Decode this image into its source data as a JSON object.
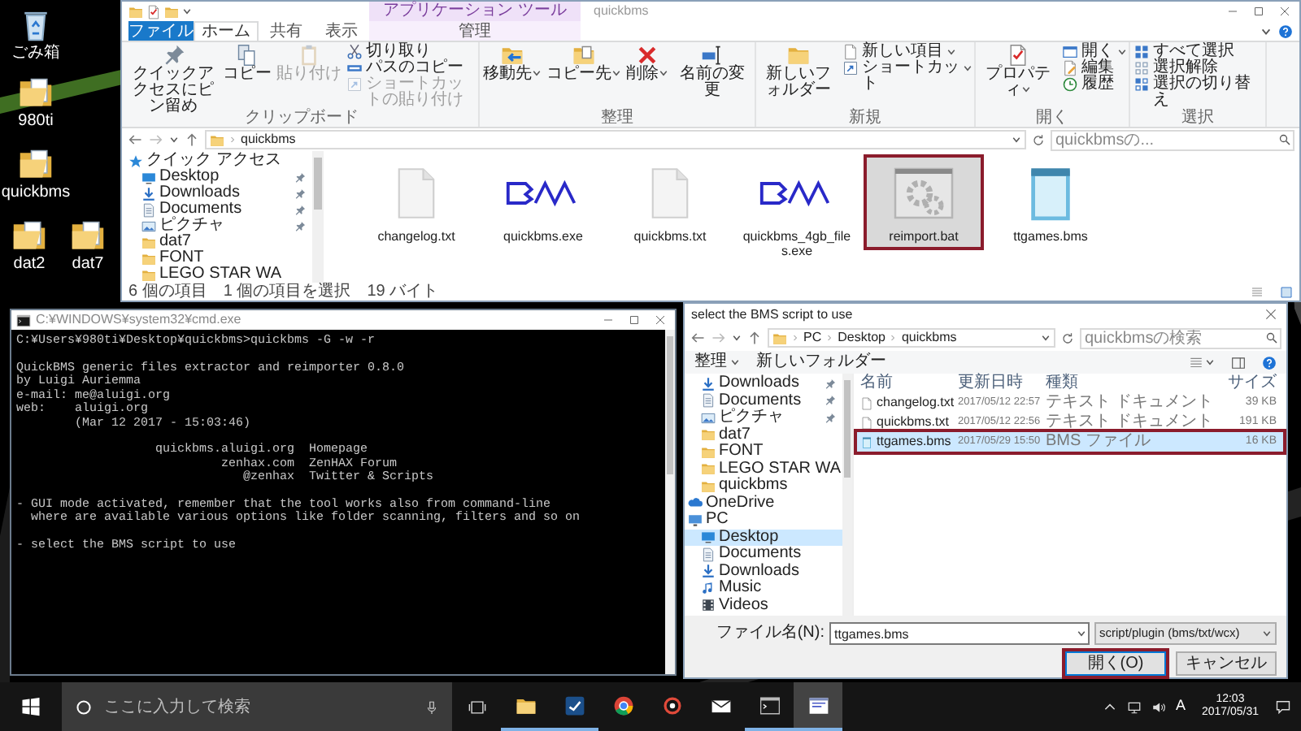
{
  "desktop_icons": [
    {
      "label": "ごみ箱",
      "kind": "recycle"
    },
    {
      "label": "980ti",
      "kind": "folder"
    },
    {
      "label": "quickbms",
      "kind": "folder"
    },
    {
      "label": "dat2",
      "kind": "folder"
    },
    {
      "label": "dat7",
      "kind": "folder"
    }
  ],
  "explorer": {
    "context_group": "アプリケーション ツール",
    "title": "quickbms",
    "tabs": [
      {
        "label": "ファイル",
        "kind": "file",
        "selected": false
      },
      {
        "label": "ホーム",
        "kind": "plain",
        "selected": true
      },
      {
        "label": "共有",
        "kind": "plain",
        "selected": false
      },
      {
        "label": "表示",
        "kind": "plain",
        "selected": false
      },
      {
        "label": "管理",
        "kind": "context",
        "selected": false
      }
    ],
    "ribbon_groups": [
      {
        "label": "クリップボード",
        "large": [
          {
            "label": "クイックアクセスにピン留め",
            "dropdown": false,
            "disabled": false
          },
          {
            "label": "コピー",
            "dropdown": false,
            "disabled": false
          },
          {
            "label": "貼り付け",
            "dropdown": false,
            "disabled": true
          }
        ],
        "small": [
          {
            "label": "切り取り",
            "dropdown": false,
            "disabled": false
          },
          {
            "label": "パスのコピー",
            "dropdown": false,
            "disabled": false
          },
          {
            "label": "ショートカットの貼り付け",
            "dropdown": false,
            "disabled": true
          }
        ]
      },
      {
        "label": "整理",
        "large": [
          {
            "label": "移動先",
            "dropdown": true,
            "disabled": false
          },
          {
            "label": "コピー先",
            "dropdown": true,
            "disabled": false
          },
          {
            "label": "削除",
            "dropdown": true,
            "disabled": false
          },
          {
            "label": "名前の変更",
            "dropdown": false,
            "disabled": false
          }
        ]
      },
      {
        "label": "新規",
        "large": [
          {
            "label": "新しいフォルダー",
            "dropdown": false,
            "disabled": false
          }
        ],
        "small": [
          {
            "label": "新しい項目",
            "dropdown": true,
            "disabled": false
          },
          {
            "label": "ショートカット",
            "dropdown": true,
            "disabled": false
          }
        ]
      },
      {
        "label": "開く",
        "large": [
          {
            "label": "プロパティ",
            "dropdown": true,
            "disabled": false
          }
        ],
        "small": [
          {
            "label": "開く",
            "dropdown": true,
            "disabled": false
          },
          {
            "label": "編集",
            "dropdown": false,
            "disabled": false
          },
          {
            "label": "履歴",
            "dropdown": false,
            "disabled": false
          }
        ]
      },
      {
        "label": "選択",
        "small": [
          {
            "label": "すべて選択",
            "dropdown": false,
            "disabled": false
          },
          {
            "label": "選択解除",
            "dropdown": false,
            "disabled": false
          },
          {
            "label": "選択の切り替え",
            "dropdown": false,
            "disabled": false
          }
        ]
      }
    ],
    "address": {
      "path": [
        "quickbms"
      ],
      "search_placeholder": "quickbmsの..."
    },
    "nav": [
      {
        "label": "クイック アクセス",
        "kind": "star",
        "pinned": false,
        "selected": false,
        "children": [
          {
            "label": "Desktop",
            "kind": "desktop",
            "pinned": true,
            "selected": false
          },
          {
            "label": "Downloads",
            "kind": "downloads",
            "pinned": true,
            "selected": false
          },
          {
            "label": "Documents",
            "kind": "documents",
            "pinned": true,
            "selected": false
          },
          {
            "label": "ピクチャ",
            "kind": "pictures",
            "pinned": true,
            "selected": false
          },
          {
            "label": "dat7",
            "kind": "folder",
            "pinned": false,
            "selected": false
          },
          {
            "label": "FONT",
            "kind": "folder",
            "pinned": false,
            "selected": false
          },
          {
            "label": "LEGO STAR WA",
            "kind": "folder",
            "pinned": false,
            "selected": false
          }
        ]
      }
    ],
    "files": [
      {
        "label": "changelog.txt",
        "kind": "text",
        "selected": false,
        "highlighted": false
      },
      {
        "label": "quickbms.exe",
        "kind": "bms",
        "selected": false,
        "highlighted": false
      },
      {
        "label": "quickbms.txt",
        "kind": "text",
        "selected": false,
        "highlighted": false
      },
      {
        "label": "quickbms_4gb_files.exe",
        "kind": "bms",
        "selected": false,
        "highlighted": false
      },
      {
        "label": "reimport.bat",
        "kind": "bat",
        "selected": true,
        "highlighted": true
      },
      {
        "label": "ttgames.bms",
        "kind": "notepad",
        "selected": false,
        "highlighted": false
      }
    ],
    "status": [
      "6 個の項目",
      "1 個の項目を選択",
      "19 バイト"
    ]
  },
  "console": {
    "title": "C:¥WINDOWS¥system32¥cmd.exe",
    "blocks": [
      [
        "C:¥Users¥980ti¥Desktop¥quickbms>quickbms -G -w -r"
      ],
      [
        "QuickBMS generic files extractor and reimporter 0.8.0",
        "by Luigi Auriemma",
        "e-mail: me@aluigi.org",
        "web:    aluigi.org",
        "        (Mar 12 2017 - 15:03:46)"
      ],
      [
        "                   quickbms.aluigi.org  Homepage",
        "                            zenhax.com  ZenHAX Forum",
        "                               @zenhax  Twitter & Scripts"
      ],
      [
        "- GUI mode activated, remember that the tool works also from command-line",
        "  where are available various options like folder scanning, filters and so on"
      ],
      [
        "- select the BMS script to use"
      ]
    ]
  },
  "dialog": {
    "title": "select the BMS script to use",
    "path": [
      "PC",
      "Desktop",
      "quickbms"
    ],
    "search_placeholder": "quickbmsの検索",
    "toolbar": [
      {
        "label": "整理",
        "dropdown": true
      },
      {
        "label": "新しいフォルダー",
        "dropdown": false
      }
    ],
    "quick_access": [
      {
        "label": "Downloads",
        "kind": "downloads",
        "pinned": true,
        "selected": false
      },
      {
        "label": "Documents",
        "kind": "documents",
        "pinned": true,
        "selected": false
      },
      {
        "label": "ピクチャ",
        "kind": "pictures",
        "pinned": true,
        "selected": false
      },
      {
        "label": "dat7",
        "kind": "folder",
        "pinned": false,
        "selected": false
      },
      {
        "label": "FONT",
        "kind": "folder",
        "pinned": false,
        "selected": false
      },
      {
        "label": "LEGO STAR WA",
        "kind": "folder",
        "pinned": false,
        "selected": false
      },
      {
        "label": "quickbms",
        "kind": "folder",
        "pinned": false,
        "selected": false
      }
    ],
    "roots": [
      {
        "label": "OneDrive",
        "kind": "onedrive",
        "pinned": false,
        "selected": false
      },
      {
        "label": "PC",
        "kind": "pc",
        "pinned": false,
        "selected": false,
        "children": [
          {
            "label": "Desktop",
            "kind": "desktop",
            "pinned": false,
            "selected": true
          },
          {
            "label": "Documents",
            "kind": "documents",
            "pinned": false,
            "selected": false
          },
          {
            "label": "Downloads",
            "kind": "downloads",
            "pinned": false,
            "selected": false
          },
          {
            "label": "Music",
            "kind": "music",
            "pinned": false,
            "selected": false
          },
          {
            "label": "Videos",
            "kind": "videos",
            "pinned": false,
            "selected": false
          }
        ]
      }
    ],
    "columns": [
      "名前",
      "更新日時",
      "種類",
      "サイズ"
    ],
    "rows": [
      {
        "kind": "text",
        "selected": false,
        "highlighted": false,
        "cells": [
          "changelog.txt",
          "2017/05/12 22:57",
          "テキスト ドキュメント",
          "39 KB"
        ]
      },
      {
        "kind": "text",
        "selected": false,
        "highlighted": false,
        "cells": [
          "quickbms.txt",
          "2017/05/12 22:56",
          "テキスト ドキュメント",
          "191 KB"
        ]
      },
      {
        "kind": "bms",
        "selected": true,
        "highlighted": true,
        "cells": [
          "ttgames.bms",
          "2017/05/29 15:50",
          "BMS ファイル",
          "16 KB"
        ]
      }
    ],
    "file_name_label": "ファイル名(N):",
    "file_name": "ttgames.bms",
    "file_type": "script/plugin (bms/txt/wcx)",
    "buttons": [
      {
        "label": "開く(O)",
        "highlighted": true
      },
      {
        "label": "キャンセル",
        "highlighted": false
      }
    ]
  },
  "taskbar": {
    "search_placeholder": "ここに入力して検索",
    "apps": [
      {
        "kind": "explorer",
        "running": true,
        "selected": false
      },
      {
        "kind": "steam",
        "running": true,
        "selected": false
      },
      {
        "kind": "chrome",
        "running": false,
        "selected": false
      },
      {
        "kind": "ring",
        "running": false,
        "selected": false
      },
      {
        "kind": "mail",
        "running": false,
        "selected": false
      },
      {
        "kind": "console",
        "running": true,
        "selected": false
      },
      {
        "kind": "window",
        "running": true,
        "selected": true
      }
    ],
    "ime": "A",
    "time": "12:03",
    "date": "2017/05/31"
  }
}
